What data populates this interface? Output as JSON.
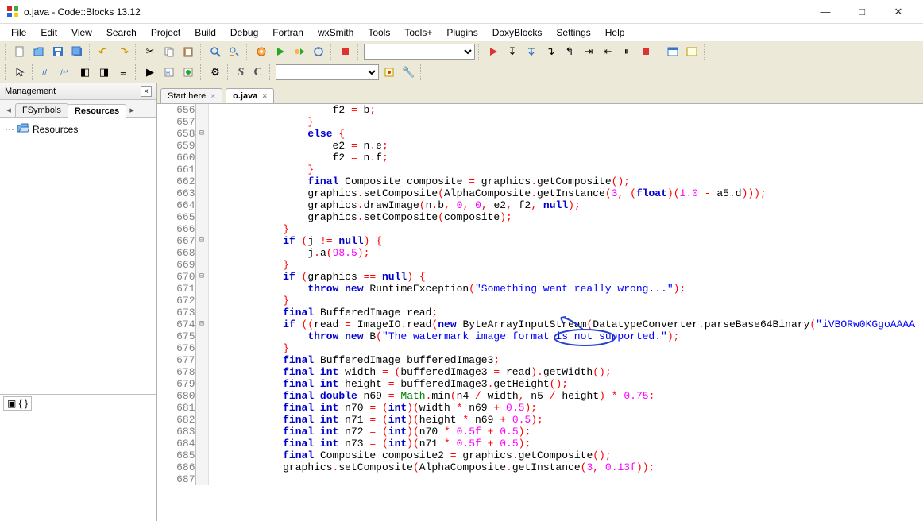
{
  "title": "o.java - Code::Blocks 13.12",
  "menu": [
    "File",
    "Edit",
    "View",
    "Search",
    "Project",
    "Build",
    "Debug",
    "Fortran",
    "wxSmith",
    "Tools",
    "Tools+",
    "Plugins",
    "DoxyBlocks",
    "Settings",
    "Help"
  ],
  "sidebar": {
    "panel_title": "Management",
    "tabs": [
      "FSymbols",
      "Resources"
    ],
    "active_tab": 1,
    "tree_root": "Resources",
    "lower": "{ }"
  },
  "editor": {
    "tabs": [
      {
        "label": "Start here",
        "active": false
      },
      {
        "label": "o.java",
        "active": true
      }
    ],
    "lines": [
      {
        "n": 656,
        "fold": "",
        "indent": 20,
        "tokens": [
          [
            "ident",
            "f2 "
          ],
          [
            "pun",
            "="
          ],
          [
            "ident",
            " b"
          ],
          [
            "pun",
            ";"
          ]
        ]
      },
      {
        "n": 657,
        "fold": "",
        "indent": 16,
        "tokens": [
          [
            "pun",
            "}"
          ]
        ]
      },
      {
        "n": 658,
        "fold": "⊟",
        "indent": 16,
        "tokens": [
          [
            "kw",
            "else"
          ],
          [
            "ident",
            " "
          ],
          [
            "pun",
            "{"
          ]
        ]
      },
      {
        "n": 659,
        "fold": "",
        "indent": 20,
        "tokens": [
          [
            "ident",
            "e2 "
          ],
          [
            "pun",
            "="
          ],
          [
            "ident",
            " n"
          ],
          [
            "pun",
            "."
          ],
          [
            "ident",
            "e"
          ],
          [
            "pun",
            ";"
          ]
        ]
      },
      {
        "n": 660,
        "fold": "",
        "indent": 20,
        "tokens": [
          [
            "ident",
            "f2 "
          ],
          [
            "pun",
            "="
          ],
          [
            "ident",
            " n"
          ],
          [
            "pun",
            "."
          ],
          [
            "ident",
            "f"
          ],
          [
            "pun",
            ";"
          ]
        ]
      },
      {
        "n": 661,
        "fold": "",
        "indent": 16,
        "tokens": [
          [
            "pun",
            "}"
          ]
        ]
      },
      {
        "n": 662,
        "fold": "",
        "indent": 16,
        "tokens": [
          [
            "kw",
            "final"
          ],
          [
            "ident",
            " Composite composite "
          ],
          [
            "pun",
            "="
          ],
          [
            "ident",
            " graphics"
          ],
          [
            "pun",
            "."
          ],
          [
            "ident",
            "getComposite"
          ],
          [
            "pun",
            "();"
          ]
        ]
      },
      {
        "n": 663,
        "fold": "",
        "indent": 16,
        "tokens": [
          [
            "ident",
            "graphics"
          ],
          [
            "pun",
            "."
          ],
          [
            "ident",
            "setComposite"
          ],
          [
            "pun",
            "("
          ],
          [
            "ident",
            "AlphaComposite"
          ],
          [
            "pun",
            "."
          ],
          [
            "ident",
            "getInstance"
          ],
          [
            "pun",
            "("
          ],
          [
            "num",
            "3"
          ],
          [
            "pun",
            ", ("
          ],
          [
            "kw",
            "float"
          ],
          [
            "pun",
            ")("
          ],
          [
            "num",
            "1.0"
          ],
          [
            "ident",
            " "
          ],
          [
            "pun",
            "-"
          ],
          [
            "ident",
            " a5"
          ],
          [
            "pun",
            "."
          ],
          [
            "ident",
            "d"
          ],
          [
            "pun",
            ")));"
          ]
        ]
      },
      {
        "n": 664,
        "fold": "",
        "indent": 16,
        "tokens": [
          [
            "ident",
            "graphics"
          ],
          [
            "pun",
            "."
          ],
          [
            "ident",
            "drawImage"
          ],
          [
            "pun",
            "("
          ],
          [
            "ident",
            "n"
          ],
          [
            "pun",
            "."
          ],
          [
            "ident",
            "b"
          ],
          [
            "pun",
            ", "
          ],
          [
            "num",
            "0"
          ],
          [
            "pun",
            ", "
          ],
          [
            "num",
            "0"
          ],
          [
            "pun",
            ", "
          ],
          [
            "ident",
            "e2"
          ],
          [
            "pun",
            ", "
          ],
          [
            "ident",
            "f2"
          ],
          [
            "pun",
            ", "
          ],
          [
            "kw",
            "null"
          ],
          [
            "pun",
            ");"
          ]
        ]
      },
      {
        "n": 665,
        "fold": "",
        "indent": 16,
        "tokens": [
          [
            "ident",
            "graphics"
          ],
          [
            "pun",
            "."
          ],
          [
            "ident",
            "setComposite"
          ],
          [
            "pun",
            "("
          ],
          [
            "ident",
            "composite"
          ],
          [
            "pun",
            ");"
          ]
        ]
      },
      {
        "n": 666,
        "fold": "",
        "indent": 12,
        "tokens": [
          [
            "pun",
            "}"
          ]
        ]
      },
      {
        "n": 667,
        "fold": "⊟",
        "indent": 12,
        "tokens": [
          [
            "kw",
            "if"
          ],
          [
            "ident",
            " "
          ],
          [
            "pun",
            "("
          ],
          [
            "ident",
            "j "
          ],
          [
            "pun",
            "!="
          ],
          [
            "ident",
            " "
          ],
          [
            "kw",
            "null"
          ],
          [
            "pun",
            ") {"
          ]
        ]
      },
      {
        "n": 668,
        "fold": "",
        "indent": 16,
        "tokens": [
          [
            "ident",
            "j"
          ],
          [
            "pun",
            "."
          ],
          [
            "ident",
            "a"
          ],
          [
            "pun",
            "("
          ],
          [
            "num",
            "98.5"
          ],
          [
            "pun",
            ");"
          ]
        ]
      },
      {
        "n": 669,
        "fold": "",
        "indent": 12,
        "tokens": [
          [
            "pun",
            "}"
          ]
        ]
      },
      {
        "n": 670,
        "fold": "⊟",
        "indent": 12,
        "tokens": [
          [
            "kw",
            "if"
          ],
          [
            "ident",
            " "
          ],
          [
            "pun",
            "("
          ],
          [
            "ident",
            "graphics "
          ],
          [
            "pun",
            "=="
          ],
          [
            "ident",
            " "
          ],
          [
            "kw",
            "null"
          ],
          [
            "pun",
            ") {"
          ]
        ]
      },
      {
        "n": 671,
        "fold": "",
        "indent": 16,
        "tokens": [
          [
            "kw",
            "throw new"
          ],
          [
            "ident",
            " RuntimeException"
          ],
          [
            "pun",
            "("
          ],
          [
            "str",
            "\"Something went really wrong...\""
          ],
          [
            "pun",
            ");"
          ]
        ]
      },
      {
        "n": 672,
        "fold": "",
        "indent": 12,
        "tokens": [
          [
            "pun",
            "}"
          ]
        ]
      },
      {
        "n": 673,
        "fold": "",
        "indent": 12,
        "tokens": [
          [
            "kw",
            "final"
          ],
          [
            "ident",
            " BufferedImage read"
          ],
          [
            "pun",
            ";"
          ]
        ]
      },
      {
        "n": 674,
        "fold": "⊟",
        "indent": 12,
        "tokens": [
          [
            "kw",
            "if"
          ],
          [
            "ident",
            " "
          ],
          [
            "pun",
            "(("
          ],
          [
            "ident",
            "read "
          ],
          [
            "pun",
            "="
          ],
          [
            "ident",
            " ImageIO"
          ],
          [
            "pun",
            "."
          ],
          [
            "ident",
            "read"
          ],
          [
            "pun",
            "("
          ],
          [
            "kw",
            "new"
          ],
          [
            "ident",
            " ByteArrayInputStream"
          ],
          [
            "pun",
            "("
          ],
          [
            "ident",
            "DatatypeConverter"
          ],
          [
            "pun",
            "."
          ],
          [
            "ident",
            "parseBase64Binary"
          ],
          [
            "pun",
            "("
          ],
          [
            "str",
            "\"iVBORw0KGgoAAAA"
          ]
        ]
      },
      {
        "n": 675,
        "fold": "",
        "indent": 16,
        "tokens": [
          [
            "kw",
            "throw new"
          ],
          [
            "ident",
            " B"
          ],
          [
            "pun",
            "("
          ],
          [
            "str",
            "\"The watermark image format is not supported.\""
          ],
          [
            "pun",
            ");"
          ]
        ]
      },
      {
        "n": 676,
        "fold": "",
        "indent": 12,
        "tokens": [
          [
            "pun",
            "}"
          ]
        ]
      },
      {
        "n": 677,
        "fold": "",
        "indent": 12,
        "tokens": [
          [
            "kw",
            "final"
          ],
          [
            "ident",
            " BufferedImage bufferedImage3"
          ],
          [
            "pun",
            ";"
          ]
        ]
      },
      {
        "n": 678,
        "fold": "",
        "indent": 12,
        "tokens": [
          [
            "kw",
            "final int"
          ],
          [
            "ident",
            " width "
          ],
          [
            "pun",
            "= ("
          ],
          [
            "ident",
            "bufferedImage3 "
          ],
          [
            "pun",
            "="
          ],
          [
            "ident",
            " read"
          ],
          [
            "pun",
            ")."
          ],
          [
            "ident",
            "getWidth"
          ],
          [
            "pun",
            "();"
          ]
        ]
      },
      {
        "n": 679,
        "fold": "",
        "indent": 12,
        "tokens": [
          [
            "kw",
            "final int"
          ],
          [
            "ident",
            " height "
          ],
          [
            "pun",
            "="
          ],
          [
            "ident",
            " bufferedImage3"
          ],
          [
            "pun",
            "."
          ],
          [
            "ident",
            "getHeight"
          ],
          [
            "pun",
            "();"
          ]
        ]
      },
      {
        "n": 680,
        "fold": "",
        "indent": 12,
        "tokens": [
          [
            "kw",
            "final double"
          ],
          [
            "ident",
            " n69 "
          ],
          [
            "pun",
            "="
          ],
          [
            "ident",
            " "
          ],
          [
            "grn",
            "Math"
          ],
          [
            "pun",
            "."
          ],
          [
            "ident",
            "min"
          ],
          [
            "pun",
            "("
          ],
          [
            "ident",
            "n4 "
          ],
          [
            "pun",
            "/"
          ],
          [
            "ident",
            " width"
          ],
          [
            "pun",
            ","
          ],
          [
            "ident",
            " n5 "
          ],
          [
            "pun",
            "/"
          ],
          [
            "ident",
            " height"
          ],
          [
            "pun",
            ") * "
          ],
          [
            "num",
            "0.75"
          ],
          [
            "pun",
            ";"
          ]
        ]
      },
      {
        "n": 681,
        "fold": "",
        "indent": 12,
        "tokens": [
          [
            "kw",
            "final int"
          ],
          [
            "ident",
            " n70 "
          ],
          [
            "pun",
            "= ("
          ],
          [
            "kw",
            "int"
          ],
          [
            "pun",
            ")("
          ],
          [
            "ident",
            "width "
          ],
          [
            "pun",
            "*"
          ],
          [
            "ident",
            " n69 "
          ],
          [
            "pun",
            "+ "
          ],
          [
            "num",
            "0.5"
          ],
          [
            "pun",
            ");"
          ]
        ]
      },
      {
        "n": 682,
        "fold": "",
        "indent": 12,
        "tokens": [
          [
            "kw",
            "final int"
          ],
          [
            "ident",
            " n71 "
          ],
          [
            "pun",
            "= ("
          ],
          [
            "kw",
            "int"
          ],
          [
            "pun",
            ")("
          ],
          [
            "ident",
            "height "
          ],
          [
            "pun",
            "*"
          ],
          [
            "ident",
            " n69 "
          ],
          [
            "pun",
            "+ "
          ],
          [
            "num",
            "0.5"
          ],
          [
            "pun",
            ");"
          ]
        ]
      },
      {
        "n": 683,
        "fold": "",
        "indent": 12,
        "tokens": [
          [
            "kw",
            "final int"
          ],
          [
            "ident",
            " n72 "
          ],
          [
            "pun",
            "= ("
          ],
          [
            "kw",
            "int"
          ],
          [
            "pun",
            ")("
          ],
          [
            "ident",
            "n70 "
          ],
          [
            "pun",
            "* "
          ],
          [
            "num",
            "0.5f"
          ],
          [
            "pun",
            " + "
          ],
          [
            "num",
            "0.5"
          ],
          [
            "pun",
            ");"
          ]
        ]
      },
      {
        "n": 684,
        "fold": "",
        "indent": 12,
        "tokens": [
          [
            "kw",
            "final int"
          ],
          [
            "ident",
            " n73 "
          ],
          [
            "pun",
            "= ("
          ],
          [
            "kw",
            "int"
          ],
          [
            "pun",
            ")("
          ],
          [
            "ident",
            "n71 "
          ],
          [
            "pun",
            "* "
          ],
          [
            "num",
            "0.5f"
          ],
          [
            "pun",
            " + "
          ],
          [
            "num",
            "0.5"
          ],
          [
            "pun",
            ");"
          ]
        ]
      },
      {
        "n": 685,
        "fold": "",
        "indent": 12,
        "tokens": [
          [
            "kw",
            "final"
          ],
          [
            "ident",
            " Composite composite2 "
          ],
          [
            "pun",
            "="
          ],
          [
            "ident",
            " graphics"
          ],
          [
            "pun",
            "."
          ],
          [
            "ident",
            "getComposite"
          ],
          [
            "pun",
            "();"
          ]
        ]
      },
      {
        "n": 686,
        "fold": "",
        "indent": 12,
        "tokens": [
          [
            "ident",
            "graphics"
          ],
          [
            "pun",
            "."
          ],
          [
            "ident",
            "setComposite"
          ],
          [
            "pun",
            "("
          ],
          [
            "ident",
            "AlphaComposite"
          ],
          [
            "pun",
            "."
          ],
          [
            "ident",
            "getInstance"
          ],
          [
            "pun",
            "("
          ],
          [
            "num",
            "3"
          ],
          [
            "pun",
            ", "
          ],
          [
            "num",
            "0.13f"
          ],
          [
            "pun",
            "));"
          ]
        ]
      },
      {
        "n": 687,
        "fold": "",
        "indent": 12,
        "tokens": [
          [
            "ident",
            " "
          ]
        ]
      }
    ]
  }
}
